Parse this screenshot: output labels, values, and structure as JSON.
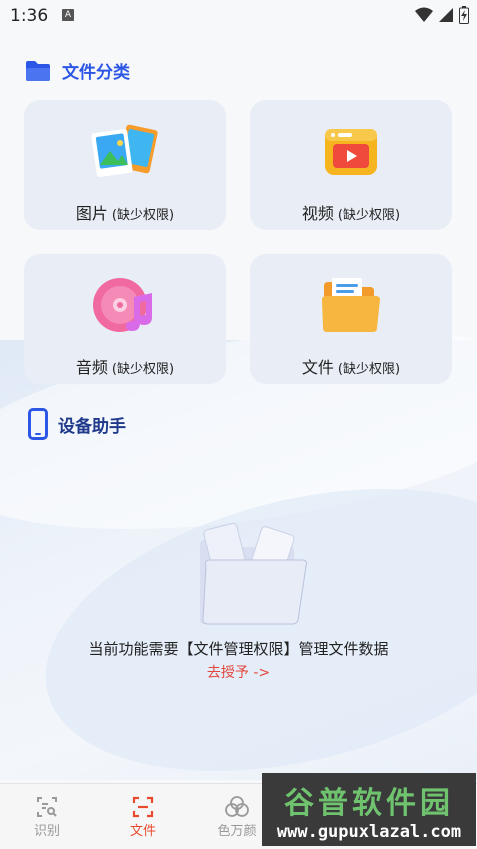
{
  "status_bar": {
    "time": "1:36",
    "notif_letter": "A"
  },
  "file_section": {
    "title": "文件分类",
    "cards": [
      {
        "name": "图片",
        "note": "(缺少权限)"
      },
      {
        "name": "视频",
        "note": "(缺少权限)"
      },
      {
        "name": "音频",
        "note": "(缺少权限)"
      },
      {
        "name": "文件",
        "note": "(缺少权限)"
      }
    ]
  },
  "device_section": {
    "title": "设备助手"
  },
  "empty_state": {
    "message": "当前功能需要【文件管理权限】管理文件数据",
    "action": "去授予 ->"
  },
  "bottom_nav": {
    "items": [
      {
        "label": "识别",
        "icon": "scan-text-icon"
      },
      {
        "label": "文件",
        "icon": "scan-frame-icon"
      },
      {
        "label": "色万颜",
        "icon": "color-circles-icon"
      }
    ],
    "active_index": 1,
    "active_color": "#e84a2e"
  },
  "watermark": {
    "title": "谷普软件园",
    "url": "www.gupuxlazal.com"
  },
  "colors": {
    "accent": "#2c57e6",
    "card_bg": "#e9eef6",
    "link": "#e2473b"
  }
}
